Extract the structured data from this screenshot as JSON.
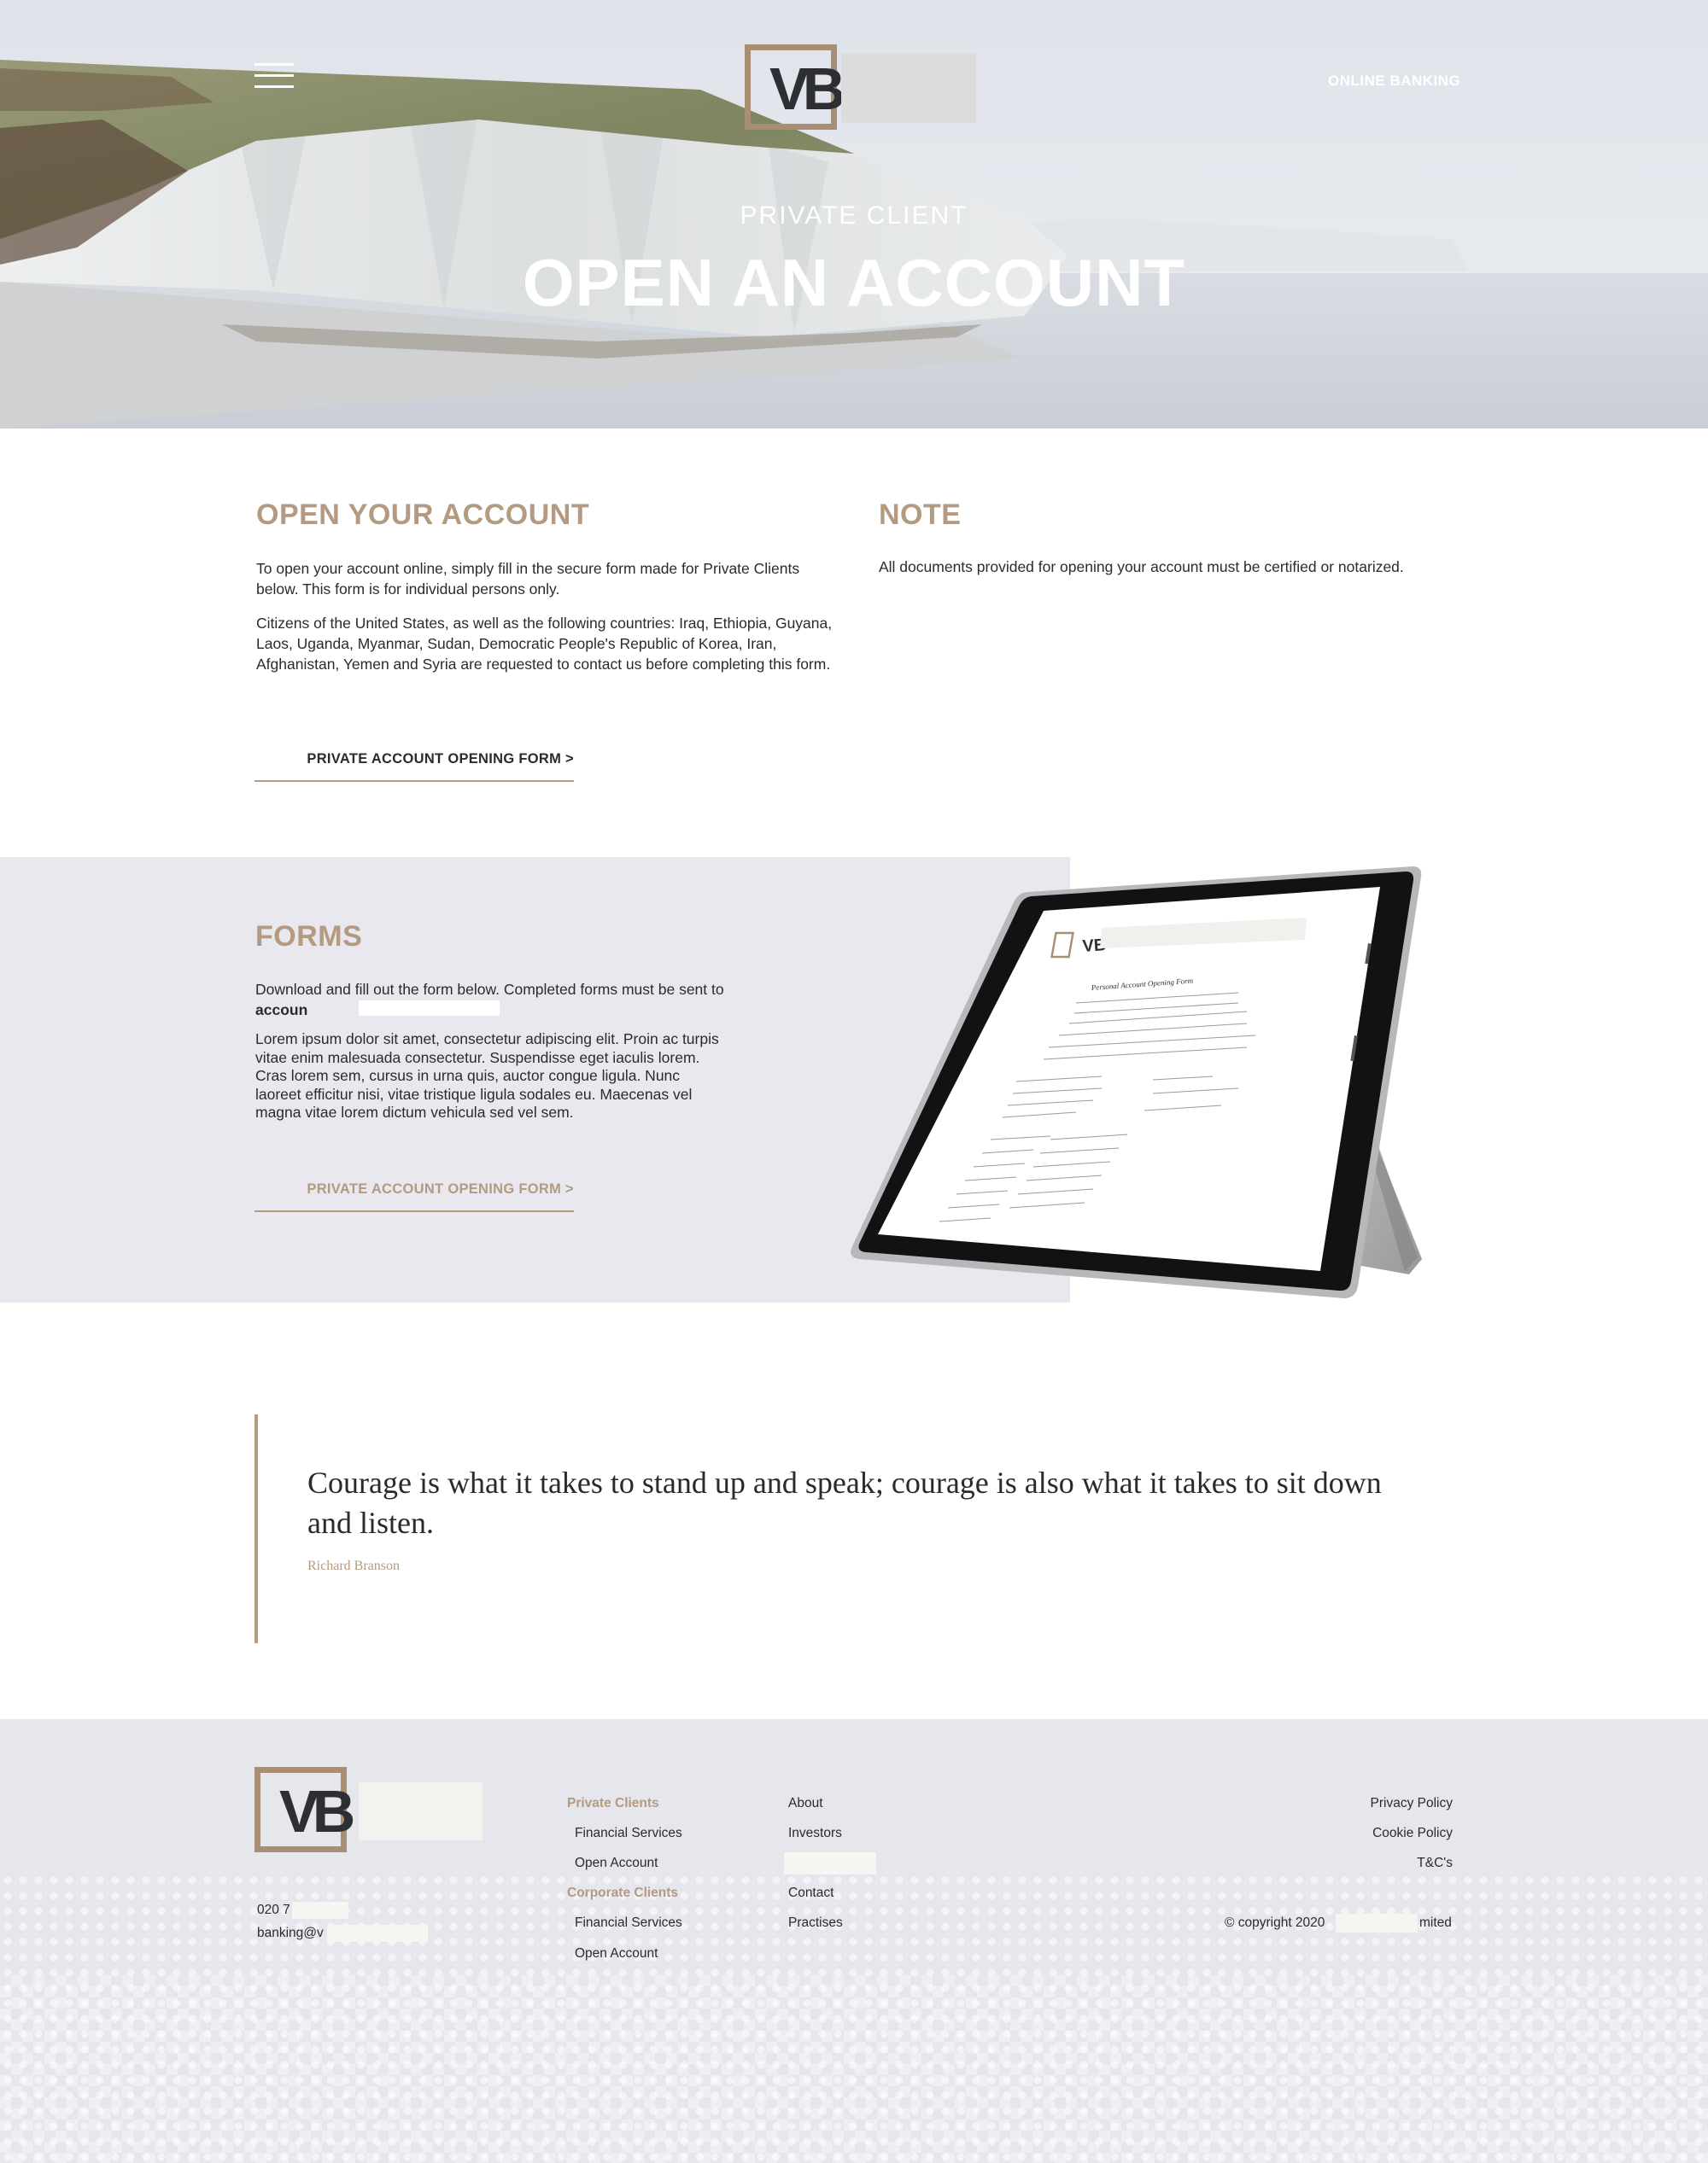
{
  "header": {
    "logo_text": "VB",
    "online_banking_label": "ONLINE BANKING",
    "subtitle": "PRIVATE CLIENT",
    "title": "OPEN AN ACCOUNT"
  },
  "open_account": {
    "heading": "OPEN YOUR ACCOUNT",
    "paragraph_1": "To open your account online, simply fill in the secure form made for Private Clients below. This form is for individual persons only.",
    "paragraph_2": "Citizens of the United States, as well as the following countries: Iraq, Ethiopia, Guyana, Laos, Uganda, Myanmar, Sudan, Democratic People's Republic of Korea, Iran, Afghanistan, Yemen and Syria are requested to contact us before completing this form.",
    "cta_label": "PRIVATE ACCOUNT OPENING FORM >"
  },
  "note": {
    "heading": "NOTE",
    "text": "All documents provided for opening your account must be certified or notarized."
  },
  "forms": {
    "heading": "FORMS",
    "text_1": "Download and fill out the form below. Completed forms must be sent to",
    "email_fragment": "accoun",
    "text_2": "Lorem ipsum dolor sit amet, consectetur adipiscing elit. Proin ac turpis vitae enim malesuada consectetur. Suspendisse eget iaculis lorem. Cras lorem sem, cursus in urna quis, auctor congue ligula. Nunc laoreet efficitur nisi, vitae tristique ligula sodales eu. Maecenas vel magna vitae lorem dictum vehicula sed vel sem.",
    "cta_label": "PRIVATE ACCOUNT OPENING FORM >",
    "tablet_logo": "VB",
    "tablet_form_title": "Personal Account Opening Form"
  },
  "quote": {
    "text": "Courage is what it takes to stand up and speak; courage is also what it takes to sit down and listen.",
    "author": "Richard Branson"
  },
  "footer": {
    "logo_text": "VB",
    "phone": "020 7",
    "email": "banking@v",
    "private_clients_heading": "Private Clients",
    "private_links": [
      "Financial Services",
      "Open Account"
    ],
    "corporate_clients_heading": "Corporate Clients",
    "corporate_links": [
      "Financial Services",
      "Open Account"
    ],
    "company_links": [
      "About",
      "Investors",
      "Contact",
      "Practises"
    ],
    "legal_links": [
      "Privacy Policy",
      "Cookie Policy",
      "T&C's"
    ],
    "copyright_prefix": "© copyright 2020",
    "copyright_suffix": "mited"
  },
  "colors": {
    "accent": "#b39a80",
    "forms_band": "#e9e8ef",
    "footer_bg": "#e6e6ed",
    "text": "#2b2b2b"
  }
}
